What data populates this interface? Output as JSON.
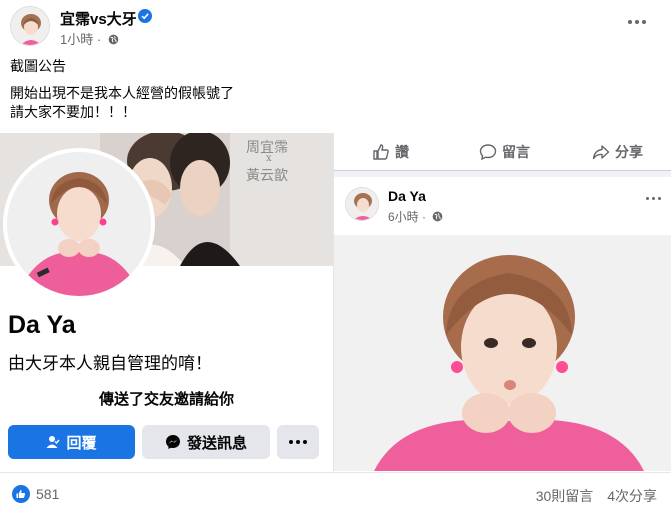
{
  "post": {
    "author": "宜霈vs大牙",
    "time": "1小時",
    "body_line1": "截圖公告",
    "body_line2": "開始出現不是我本人經營的假帳號了",
    "body_line3": "請大家不要加！！！"
  },
  "screenshot_left": {
    "cover_name_1": "周宜霈",
    "cover_x": "x",
    "cover_name_2": "黃云歆",
    "profile_name": "Da Ya",
    "profile_bio": "由大牙本人親自管理的唷！",
    "friend_notice": "傳送了交友邀請給你",
    "reply_button": "回覆",
    "message_button": "發送訊息"
  },
  "screenshot_right": {
    "like_label": "讚",
    "comment_label": "留言",
    "share_label": "分享",
    "inner_author": "Da Ya",
    "inner_time": "6小時"
  },
  "footer": {
    "reaction_count": "581",
    "comments": "30則留言",
    "shares": "4次分享"
  },
  "colors": {
    "facebook_blue": "#1b74e4",
    "text_secondary": "#65676b",
    "button_gray": "#e4e6eb"
  }
}
